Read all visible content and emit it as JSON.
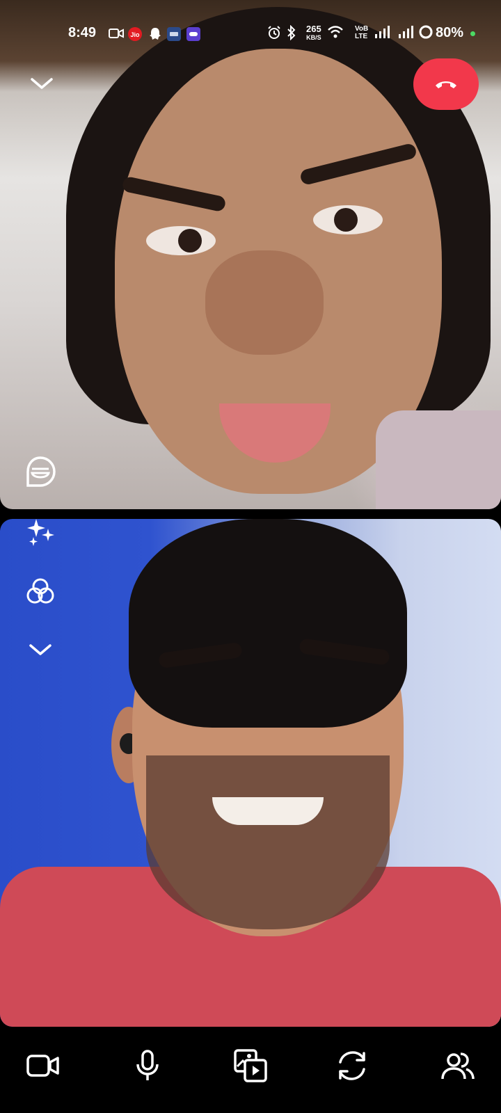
{
  "status_bar": {
    "time": "8:49",
    "speed_value": "265",
    "speed_unit": "KB/S",
    "network_label_top": "VoB",
    "network_label_bottom": "LTE",
    "battery": "80%",
    "icons": [
      "video-icon",
      "jio-icon",
      "snap-icon",
      "news-icon",
      "app-icon",
      "alarm-icon",
      "bluetooth-icon",
      "wifi-icon",
      "signal-icon",
      "signal-icon",
      "battery-icon"
    ]
  },
  "call": {
    "end_call_label": "End call",
    "top_controls": [
      "collapse-icon",
      "end-call-icon"
    ],
    "left_controls": [
      "lens-icon",
      "sparkle-effects-icon",
      "filters-icon",
      "collapse-effects-icon"
    ],
    "bottom_controls": [
      "camera-toggle-icon",
      "microphone-icon",
      "media-share-icon",
      "flip-camera-icon",
      "participants-icon"
    ]
  },
  "colors": {
    "end_call": "#f2384b",
    "background": "#000000",
    "status_dot": "#4cd964"
  }
}
